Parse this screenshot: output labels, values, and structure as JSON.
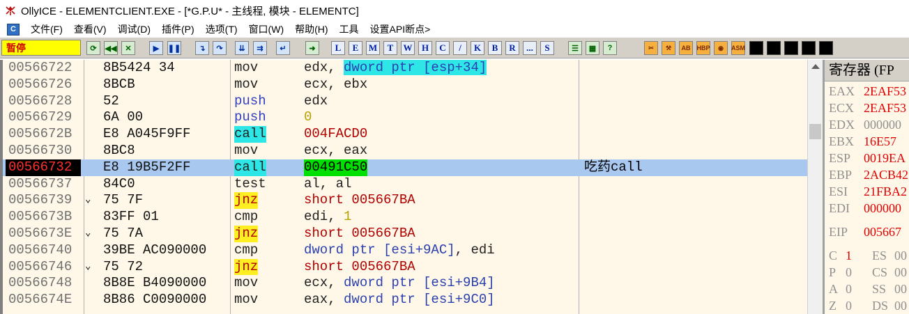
{
  "window": {
    "title": "OllyICE - ELEMENTCLIENT.EXE - [*G.P.U* - 主线程, 模块 - ELEMENTC]"
  },
  "menu": {
    "sys_icon": "C",
    "items": [
      "文件(F)",
      "查看(V)",
      "调试(D)",
      "插件(P)",
      "选项(T)",
      "窗口(W)",
      "帮助(H)",
      "工具",
      "设置API断点>"
    ]
  },
  "toolbar": {
    "status": "暂停",
    "letters": [
      "L",
      "E",
      "M",
      "T",
      "W",
      "H",
      "C",
      "/",
      "K",
      "B",
      "R",
      "...",
      "S"
    ],
    "right_labels": [
      "HBP",
      "ASM"
    ]
  },
  "disasm": {
    "rows": [
      {
        "addr": "00566722",
        "jmp": "",
        "hex": "8B5424 34",
        "op": "mov",
        "arg_pre": "edx, ",
        "arg_hl": "dword ptr [esp+34]",
        "comment": ""
      },
      {
        "addr": "00566726",
        "jmp": "",
        "hex": "8BCB",
        "op": "mov",
        "arg": "ecx, ebx",
        "comment": ""
      },
      {
        "addr": "00566728",
        "jmp": "",
        "hex": "52",
        "op": "push",
        "arg": "edx",
        "comment": ""
      },
      {
        "addr": "00566729",
        "jmp": "",
        "hex": "6A 00",
        "op": "push",
        "arg": "0",
        "comment": ""
      },
      {
        "addr": "0056672B",
        "jmp": "",
        "hex": "E8 A045F9FF",
        "op": "call",
        "arg": "004FACD0",
        "comment": ""
      },
      {
        "addr": "00566730",
        "jmp": "",
        "hex": "8BC8",
        "op": "mov",
        "arg": "ecx, eax",
        "comment": ""
      },
      {
        "addr": "00566732",
        "jmp": "",
        "hex": "E8 19B5F2FF",
        "op": "call",
        "arg": "00491C50",
        "comment": "吃药call"
      },
      {
        "addr": "00566737",
        "jmp": "",
        "hex": "84C0",
        "op": "test",
        "arg": "al, al",
        "comment": ""
      },
      {
        "addr": "00566739",
        "jmp": "⌄",
        "hex": "75 7F",
        "op": "jnz",
        "arg": "short 005667BA",
        "comment": ""
      },
      {
        "addr": "0056673B",
        "jmp": "",
        "hex": "83FF 01",
        "op": "cmp",
        "arg_pre": "edi, ",
        "arg_num": "1",
        "comment": ""
      },
      {
        "addr": "0056673E",
        "jmp": "⌄",
        "hex": "75 7A",
        "op": "jnz",
        "arg": "short 005667BA",
        "comment": ""
      },
      {
        "addr": "00566740",
        "jmp": "",
        "hex": "39BE AC090000",
        "op": "cmp",
        "arg_pre": "dword ptr [esi+9AC]",
        "arg_post": ", edi",
        "comment": ""
      },
      {
        "addr": "00566746",
        "jmp": "⌄",
        "hex": "75 72",
        "op": "jnz",
        "arg": "short 005667BA",
        "comment": ""
      },
      {
        "addr": "00566748",
        "jmp": "",
        "hex": "8B8E B4090000",
        "op": "mov",
        "arg_pre": "ecx, ",
        "arg_mem": "dword ptr [esi+9B4]",
        "comment": ""
      },
      {
        "addr": "0056674E",
        "jmp": "",
        "hex": "8B86 C0090000",
        "op": "mov",
        "arg_pre": "eax, ",
        "arg_mem": "dword ptr [esi+9C0]",
        "comment": ""
      }
    ]
  },
  "registers": {
    "header": "寄存器 (FP",
    "regs": [
      {
        "name": "EAX",
        "value": "2EAF53"
      },
      {
        "name": "ECX",
        "value": "2EAF53"
      },
      {
        "name": "EDX",
        "value": "000000"
      },
      {
        "name": "EBX",
        "value": "16E57"
      },
      {
        "name": "ESP",
        "value": "0019EA"
      },
      {
        "name": "EBP",
        "value": "2ACB42"
      },
      {
        "name": "ESI",
        "value": "21FBA2"
      },
      {
        "name": "EDI",
        "value": "000000"
      }
    ],
    "eip": {
      "name": "EIP",
      "value": "005667"
    },
    "flags": [
      {
        "f": "C",
        "v": "1",
        "seg": "ES",
        "sv": "00"
      },
      {
        "f": "P",
        "v": "0",
        "seg": "CS",
        "sv": "00"
      },
      {
        "f": "A",
        "v": "0",
        "seg": "SS",
        "sv": "00"
      },
      {
        "f": "Z",
        "v": "0",
        "seg": "DS",
        "sv": "00"
      }
    ]
  }
}
